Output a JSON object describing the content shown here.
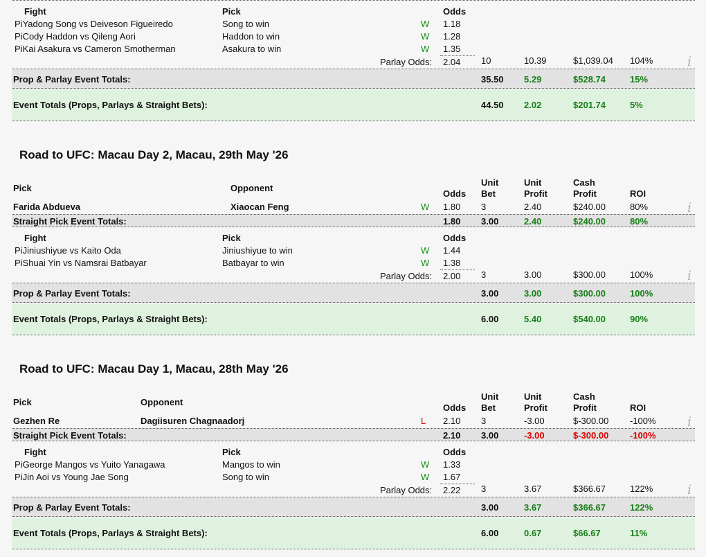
{
  "labels": {
    "fight": "Fight",
    "pick": "Pick",
    "odds": "Odds",
    "opponent": "Opponent",
    "unit_bet_1": "Unit",
    "unit_bet_2": "Bet",
    "unit_profit_1": "Unit",
    "unit_profit_2": "Profit",
    "cash_profit_1": "Cash",
    "cash_profit_2": "Profit",
    "roi": "ROI",
    "parlay_odds": "Parlay Odds:",
    "prop_parlay_totals": "Prop & Parlay Event Totals:",
    "event_totals": "Event Totals (Props, Parlays & Straight Bets):",
    "straight_totals": "Straight Pick Event Totals:",
    "prefix": "Pi",
    "info_icon": "i"
  },
  "colors": {
    "green_bar": "#dff2df",
    "grey_bar": "#e2e2e2",
    "win": "#138a13",
    "loss": "#dd0000"
  },
  "section0": {
    "legs": [
      {
        "fight": "Yadong Song vs Deiveson Figueiredo",
        "pick": "Song to win",
        "result": "W",
        "odds": "1.18"
      },
      {
        "fight": "Cody Haddon vs Qileng Aori",
        "pick": "Haddon to win",
        "result": "W",
        "odds": "1.28"
      },
      {
        "fight": "Kai Asakura vs Cameron Smotherman",
        "pick": "Asakura to win",
        "result": "W",
        "odds": "1.35"
      }
    ],
    "parlay": {
      "odds": "2.04",
      "bet": "10",
      "unit_profit": "10.39",
      "cash": "$1,039.04",
      "roi": "104%"
    },
    "prop_totals": {
      "bet": "35.50",
      "unit_profit": "5.29",
      "cash": "$528.74",
      "roi": "15%"
    },
    "event_totals": {
      "bet": "44.50",
      "unit_profit": "2.02",
      "cash": "$201.74",
      "roi": "5%"
    }
  },
  "section1": {
    "title": "Road to UFC: Macau Day 2, Macau, 29th May '26",
    "straight": {
      "pick": "Farida Abdueva",
      "opponent": "Xiaocan Feng",
      "result": "W",
      "odds": "1.80",
      "bet": "3",
      "unit_profit": "2.40",
      "cash": "$240.00",
      "roi": "80%"
    },
    "straight_totals": {
      "odds": "1.80",
      "bet": "3.00",
      "unit_profit": "2.40",
      "cash": "$240.00",
      "roi": "80%"
    },
    "legs": [
      {
        "fight": "Jiniushiyue vs Kaito Oda",
        "pick": "Jiniushiyue to win",
        "result": "W",
        "odds": "1.44"
      },
      {
        "fight": "Shuai Yin vs Namsrai Batbayar",
        "pick": "Batbayar to win",
        "result": "W",
        "odds": "1.38"
      }
    ],
    "parlay": {
      "odds": "2.00",
      "bet": "3",
      "unit_profit": "3.00",
      "cash": "$300.00",
      "roi": "100%"
    },
    "prop_totals": {
      "bet": "3.00",
      "unit_profit": "3.00",
      "cash": "$300.00",
      "roi": "100%"
    },
    "event_totals": {
      "bet": "6.00",
      "unit_profit": "5.40",
      "cash": "$540.00",
      "roi": "90%"
    }
  },
  "section2": {
    "title": "Road to UFC: Macau Day 1, Macau, 28th May '26",
    "straight": {
      "pick": "Gezhen Re",
      "opponent": "Dagiisuren Chagnaadorj",
      "result": "L",
      "odds": "2.10",
      "bet": "3",
      "unit_profit": "-3.00",
      "cash": "$-300.00",
      "roi": "-100%"
    },
    "straight_totals": {
      "odds": "2.10",
      "bet": "3.00",
      "unit_profit": "-3.00",
      "cash": "$-300.00",
      "roi": "-100%"
    },
    "legs": [
      {
        "fight": "George Mangos vs Yuito Yanagawa",
        "pick": "Mangos to win",
        "result": "W",
        "odds": "1.33"
      },
      {
        "fight": "Jin Aoi vs Young Jae Song",
        "pick": "Song to win",
        "result": "W",
        "odds": "1.67"
      }
    ],
    "parlay": {
      "odds": "2.22",
      "bet": "3",
      "unit_profit": "3.67",
      "cash": "$366.67",
      "roi": "122%"
    },
    "prop_totals": {
      "bet": "3.00",
      "unit_profit": "3.67",
      "cash": "$366.67",
      "roi": "122%"
    },
    "event_totals": {
      "bet": "6.00",
      "unit_profit": "0.67",
      "cash": "$66.67",
      "roi": "11%"
    }
  }
}
